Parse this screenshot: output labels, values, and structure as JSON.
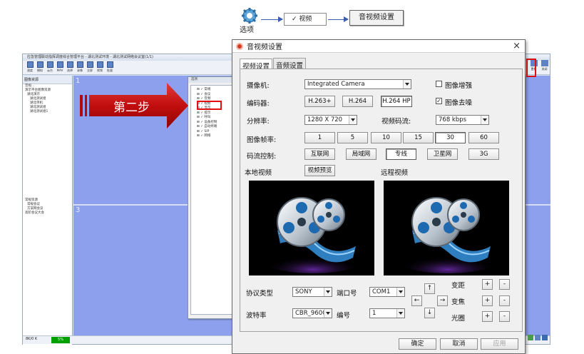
{
  "flow": {
    "options_label": "选项",
    "video_label": "视频",
    "av_settings_label": "音视频设置"
  },
  "annotation": {
    "step_label": "第二步"
  },
  "background_app": {
    "title": "应急管理联动指挥调度综合管理平台 - 湖北测试环境 - 湖北测试网络会议室(1/1)",
    "toolbar": [
      "速度",
      "模拟",
      "云台",
      "MAV",
      "选择",
      "录像",
      "全屏",
      "视频",
      "批量"
    ],
    "left_toolbar": "图像资源",
    "tree": [
      "音视...",
      "演示平台图像资源",
      "湖北演示",
      "湖北测试组",
      "湖北单机",
      "湖北测试组",
      "湖北测试组1"
    ],
    "tree2": [
      "常规资源",
      "常规会议",
      "方案网会议",
      "高阶会议大会"
    ],
    "pane_numbers": [
      "1",
      "3"
    ],
    "bandwidth": "8K/0 K",
    "percent": "5%",
    "right_buttons": [
      "更新",
      "关闭"
    ]
  },
  "mini_dialog": {
    "title": "选项",
    "items": [
      "常规",
      "会议",
      "音频",
      "视频",
      "显示",
      "提示",
      "呼叫",
      "设备控制",
      "自动终端",
      "SIP",
      "网络"
    ]
  },
  "dialog": {
    "title": "音视频设置",
    "close_glyph": "×",
    "tabs": [
      "视频设置",
      "音频设置"
    ],
    "camera_label": "摄像机:",
    "camera_value": "Integrated Camera",
    "image_enhance": "图像增强",
    "image_enhance_checked": "",
    "encoder_label": "编码器:",
    "encoders": [
      "H.263+",
      "H.264",
      "H.264 HP"
    ],
    "denoise": "图像去噪",
    "denoise_checked": "✓",
    "resolution_label": "分辨率:",
    "resolution_value": "1280 X 720",
    "bitrate_label": "视频码流:",
    "bitrate_value": "768  kbps",
    "framerate_label": "图像帧率:",
    "framerates": [
      "1",
      "5",
      "10",
      "15",
      "30",
      "60"
    ],
    "stream_label": "码流控制:",
    "streams": [
      "互联网",
      "局域网",
      "专线",
      "卫星网",
      "3G"
    ],
    "local_video": "本地视频",
    "preview_button": "视频预览",
    "remote_video": "远程视频",
    "protocol_label": "协议类型",
    "protocol_value": "SONY",
    "port_label": "端口号",
    "port_value": "COM1",
    "baud_label": "波特率",
    "baud_value": "CBR_9600",
    "number_label": "编号",
    "number_value": "1",
    "ptz": {
      "up": "↑",
      "down": "↓",
      "left": "←",
      "right": "→"
    },
    "zoom_label": "变距",
    "focus_label": "变焦",
    "iris_label": "光圈",
    "plus": "+",
    "minus": "-",
    "ok": "确定",
    "cancel": "取消",
    "apply": "应用"
  }
}
